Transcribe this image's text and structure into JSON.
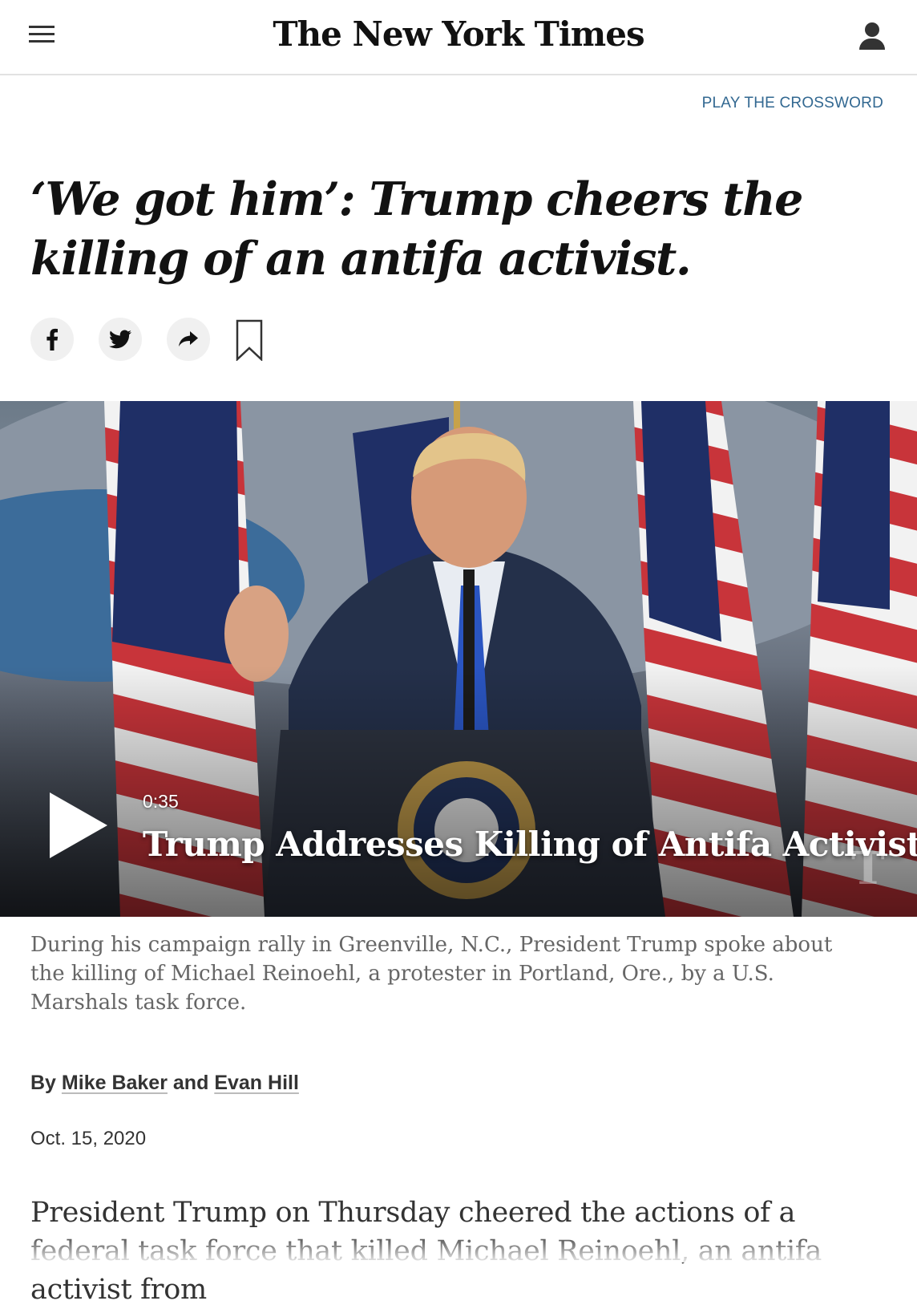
{
  "masthead": {
    "logo": "The New York Times",
    "menu_icon": "hamburger-menu-icon",
    "account_icon": "user-account-icon"
  },
  "crossword_link": "PLAY THE CROSSWORD",
  "article": {
    "headline": "‘We got him’: Trump cheers the killing of an antifa activist.",
    "share": {
      "facebook_icon": "facebook-icon",
      "twitter_icon": "twitter-icon",
      "share_icon": "share-arrow-icon",
      "bookmark_icon": "bookmark-icon"
    },
    "video": {
      "duration": "0:35",
      "title": "Trump Addresses Killing of Antifa Activist",
      "play_icon": "play-icon"
    },
    "caption": "During his campaign rally in Greenville, N.C., President Trump spoke about the killing of Michael Reinoehl, a protester in Portland, Ore., by a U.S. Marshals task force.",
    "byline": {
      "prefix": "By",
      "author1": "Mike Baker",
      "conjunction": "and",
      "author2": "Evan Hill"
    },
    "date": "Oct. 15, 2020",
    "body": "President Trump on Thursday cheered the actions of a federal task force that killed Michael Reinoehl, an antifa activist from"
  },
  "colors": {
    "link_blue": "#326891",
    "caption_gray": "#666666",
    "text_dark": "#121212"
  }
}
